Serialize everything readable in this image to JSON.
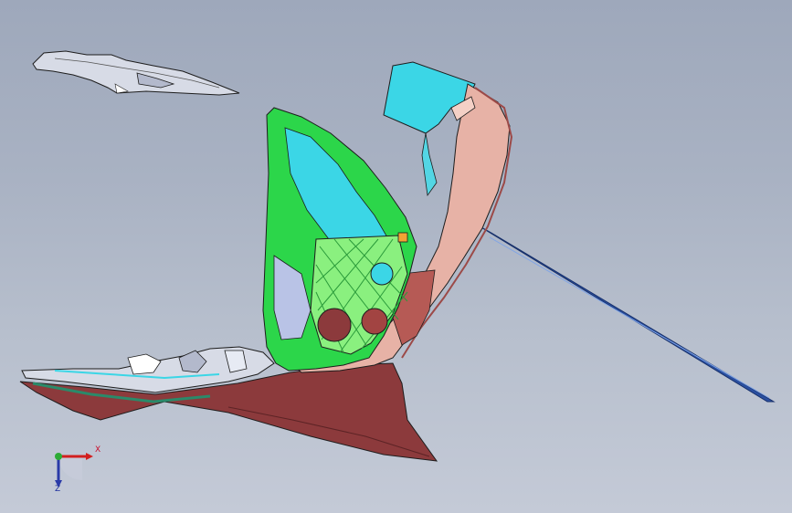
{
  "axis_triad": {
    "x_label": "X",
    "z_label": "Z",
    "colors": {
      "x": "#d21f1f",
      "y": "#2cab36",
      "z": "#2a3aa8"
    }
  },
  "model": {
    "colors": {
      "shell": "#8c3a3c",
      "shell_light": "#e7b2a6",
      "bracket": "#2cd64a",
      "lattice": "#8af07f",
      "duct": "#3bd6e6",
      "rod": "#2a4fa0",
      "part_gray": "#d7dbe6",
      "edges": "#1d1d1d"
    }
  }
}
